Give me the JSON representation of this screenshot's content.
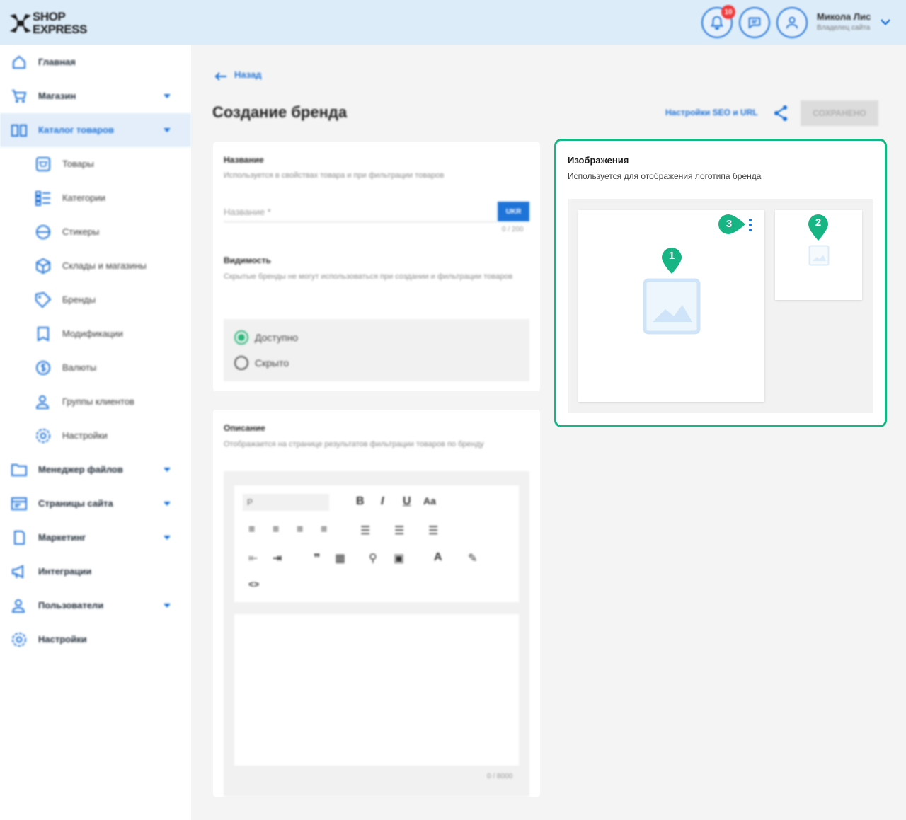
{
  "header": {
    "logo_line1": "SHOP",
    "logo_line2": "EXPRESS",
    "notifications_count": "10",
    "user_name": "Микола Лис",
    "user_role": "Владелец сайта"
  },
  "sidebar": {
    "items": [
      {
        "label": "Главная",
        "icon": "home-icon",
        "has_arrow": false
      },
      {
        "label": "Магазин",
        "icon": "cart-icon",
        "has_arrow": true
      },
      {
        "label": "Каталог товаров",
        "icon": "book-icon",
        "has_arrow": true,
        "active": true
      },
      {
        "label": "Товары",
        "icon": "product-icon",
        "sub": true
      },
      {
        "label": "Категории",
        "icon": "categories-icon",
        "sub": true
      },
      {
        "label": "Стикеры",
        "icon": "sticker-icon",
        "sub": true
      },
      {
        "label": "Склады и магазины",
        "icon": "warehouse-icon",
        "sub": true
      },
      {
        "label": "Бренды",
        "icon": "tag-icon",
        "sub": true
      },
      {
        "label": "Модификации",
        "icon": "modification-icon",
        "sub": true
      },
      {
        "label": "Валюты",
        "icon": "currency-icon",
        "sub": true
      },
      {
        "label": "Группы клиентов",
        "icon": "customer-group-icon",
        "sub": true
      },
      {
        "label": "Настройки",
        "icon": "gear-icon",
        "sub": true
      },
      {
        "label": "Менеджер файлов",
        "icon": "folder-icon",
        "has_arrow": true
      },
      {
        "label": "Страницы сайта",
        "icon": "pages-icon",
        "has_arrow": true
      },
      {
        "label": "Маркетинг",
        "icon": "marketing-icon",
        "has_arrow": true
      },
      {
        "label": "Интеграции",
        "icon": "megaphone-icon",
        "has_arrow": false
      },
      {
        "label": "Пользователи",
        "icon": "users-icon",
        "has_arrow": true
      },
      {
        "label": "Настройки",
        "icon": "gear-icon",
        "has_arrow": false
      }
    ]
  },
  "main": {
    "back_label": "Назад",
    "page_title": "Создание бренда",
    "seo_link": "Настройки SEO и URL",
    "save_label": "СОХРАНЕНО",
    "name_section": {
      "title": "Название",
      "subtitle": "Используется в свойствах товара и при фильтрации товаров",
      "placeholder": "Название *",
      "lang": "UKR",
      "counter": "0 / 200"
    },
    "visibility": {
      "title": "Видимость",
      "subtitle": "Скрытые бренды не могут использоваться при создании и фильтрации товаров",
      "options": [
        {
          "label": "Доступно",
          "selected": true
        },
        {
          "label": "Скрыто",
          "selected": false
        }
      ]
    },
    "description": {
      "title": "Описание",
      "subtitle": "Отображается на странице результатов фильтрации товаров по бренду",
      "format_select": "P",
      "counter": "0 / 8000"
    },
    "images": {
      "title": "Изображения",
      "subtitle": "Используется для отображения логотипа бренда",
      "callouts": [
        "1",
        "2",
        "3"
      ]
    }
  },
  "colors": {
    "accent": "#1e73d8",
    "highlight": "#17b584",
    "badge": "#ef3b3b"
  }
}
